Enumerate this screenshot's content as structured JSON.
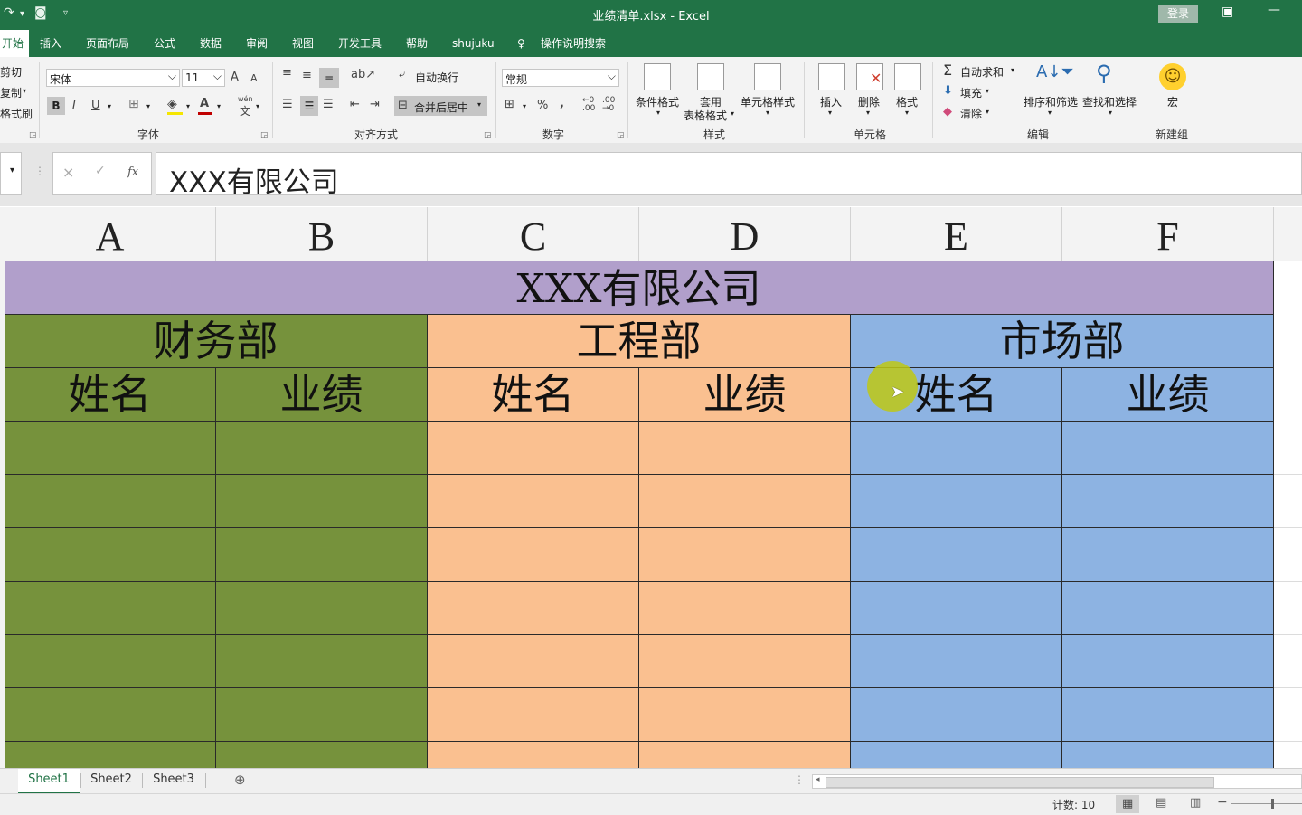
{
  "window": {
    "title": "业绩清单.xlsx  -  Excel",
    "login": "登录"
  },
  "tabs": [
    "开始",
    "插入",
    "页面布局",
    "公式",
    "数据",
    "审阅",
    "视图",
    "开发工具",
    "帮助",
    "shujuku",
    "操作说明搜索"
  ],
  "ribbon": {
    "clipboard": {
      "cut": "剪切",
      "copy": "复制",
      "format_painter": "格式刷"
    },
    "font": {
      "name": "宋体",
      "size": "11",
      "group": "字体",
      "grow": "A",
      "shrink": "A",
      "bold": "B",
      "italic": "I",
      "underline": "U",
      "wen": "wén",
      "wen_char": "文"
    },
    "align": {
      "wrap": "自动换行",
      "merge": "合并后居中",
      "group": "对齐方式"
    },
    "number": {
      "format": "常规",
      "percent": "%",
      "comma": ",",
      "inc": "←0 .00",
      "dec": ".00 →0",
      "group": "数字"
    },
    "styles": {
      "cond": "条件格式",
      "table1": "套用",
      "table2": "表格格式",
      "cell": "单元格样式",
      "group": "样式"
    },
    "cells": {
      "insert": "插入",
      "delete": "删除",
      "format": "格式",
      "group": "单元格"
    },
    "editing": {
      "autosum": "自动求和",
      "fill": "填充",
      "clear": "清除",
      "sort": "排序和筛选",
      "find": "查找和选择",
      "group": "编辑"
    },
    "macro": {
      "label": "宏",
      "group": "新建组"
    }
  },
  "formula_bar": {
    "cancel": "×",
    "enter": "✓",
    "fx": "fx",
    "value": "XXX有限公司"
  },
  "columns": [
    "A",
    "B",
    "C",
    "D",
    "E",
    "F"
  ],
  "sheet": {
    "title": "XXX有限公司",
    "departments": [
      "财务部",
      "工程部",
      "市场部"
    ],
    "sub_headers": [
      "姓名",
      "业绩",
      "姓名",
      "业绩",
      "姓名",
      "业绩"
    ],
    "colors": {
      "title": "#b19fcb",
      "finance": "#76923c",
      "engineering": "#fac090",
      "marketing": "#8db3e2"
    }
  },
  "sheet_tabs": [
    "Sheet1",
    "Sheet2",
    "Sheet3"
  ],
  "status": {
    "count": "计数: 10"
  }
}
